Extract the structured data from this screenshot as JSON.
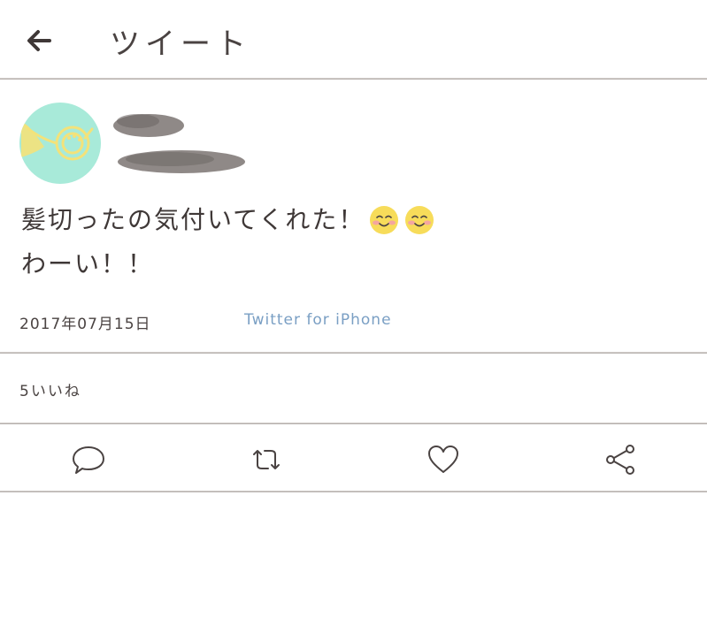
{
  "header": {
    "title": "ツイート",
    "back_icon": "arrow-left-icon"
  },
  "tweet": {
    "avatar_icon": "french-horn-icon",
    "text_line1": "髪切ったの気付いてくれた！",
    "text_line2": "わーい！！",
    "emoji": [
      "smiling-face-icon",
      "smiling-face-icon"
    ],
    "date": "2017年07月15日",
    "source": "Twitter for iPhone",
    "likes": "5いいね"
  },
  "actions": [
    {
      "name": "reply",
      "icon": "speech-bubble-icon"
    },
    {
      "name": "retweet",
      "icon": "retweet-arrows-icon"
    },
    {
      "name": "like",
      "icon": "heart-icon"
    },
    {
      "name": "share",
      "icon": "share-icon"
    }
  ],
  "colors": {
    "avatar_bg": "#a8ead9",
    "horn": "#f3e27a",
    "source_link": "#7a9fc4",
    "text": "#4a4342",
    "emoji_face": "#f7dc5a",
    "emoji_cheek": "#f4a6a0"
  }
}
